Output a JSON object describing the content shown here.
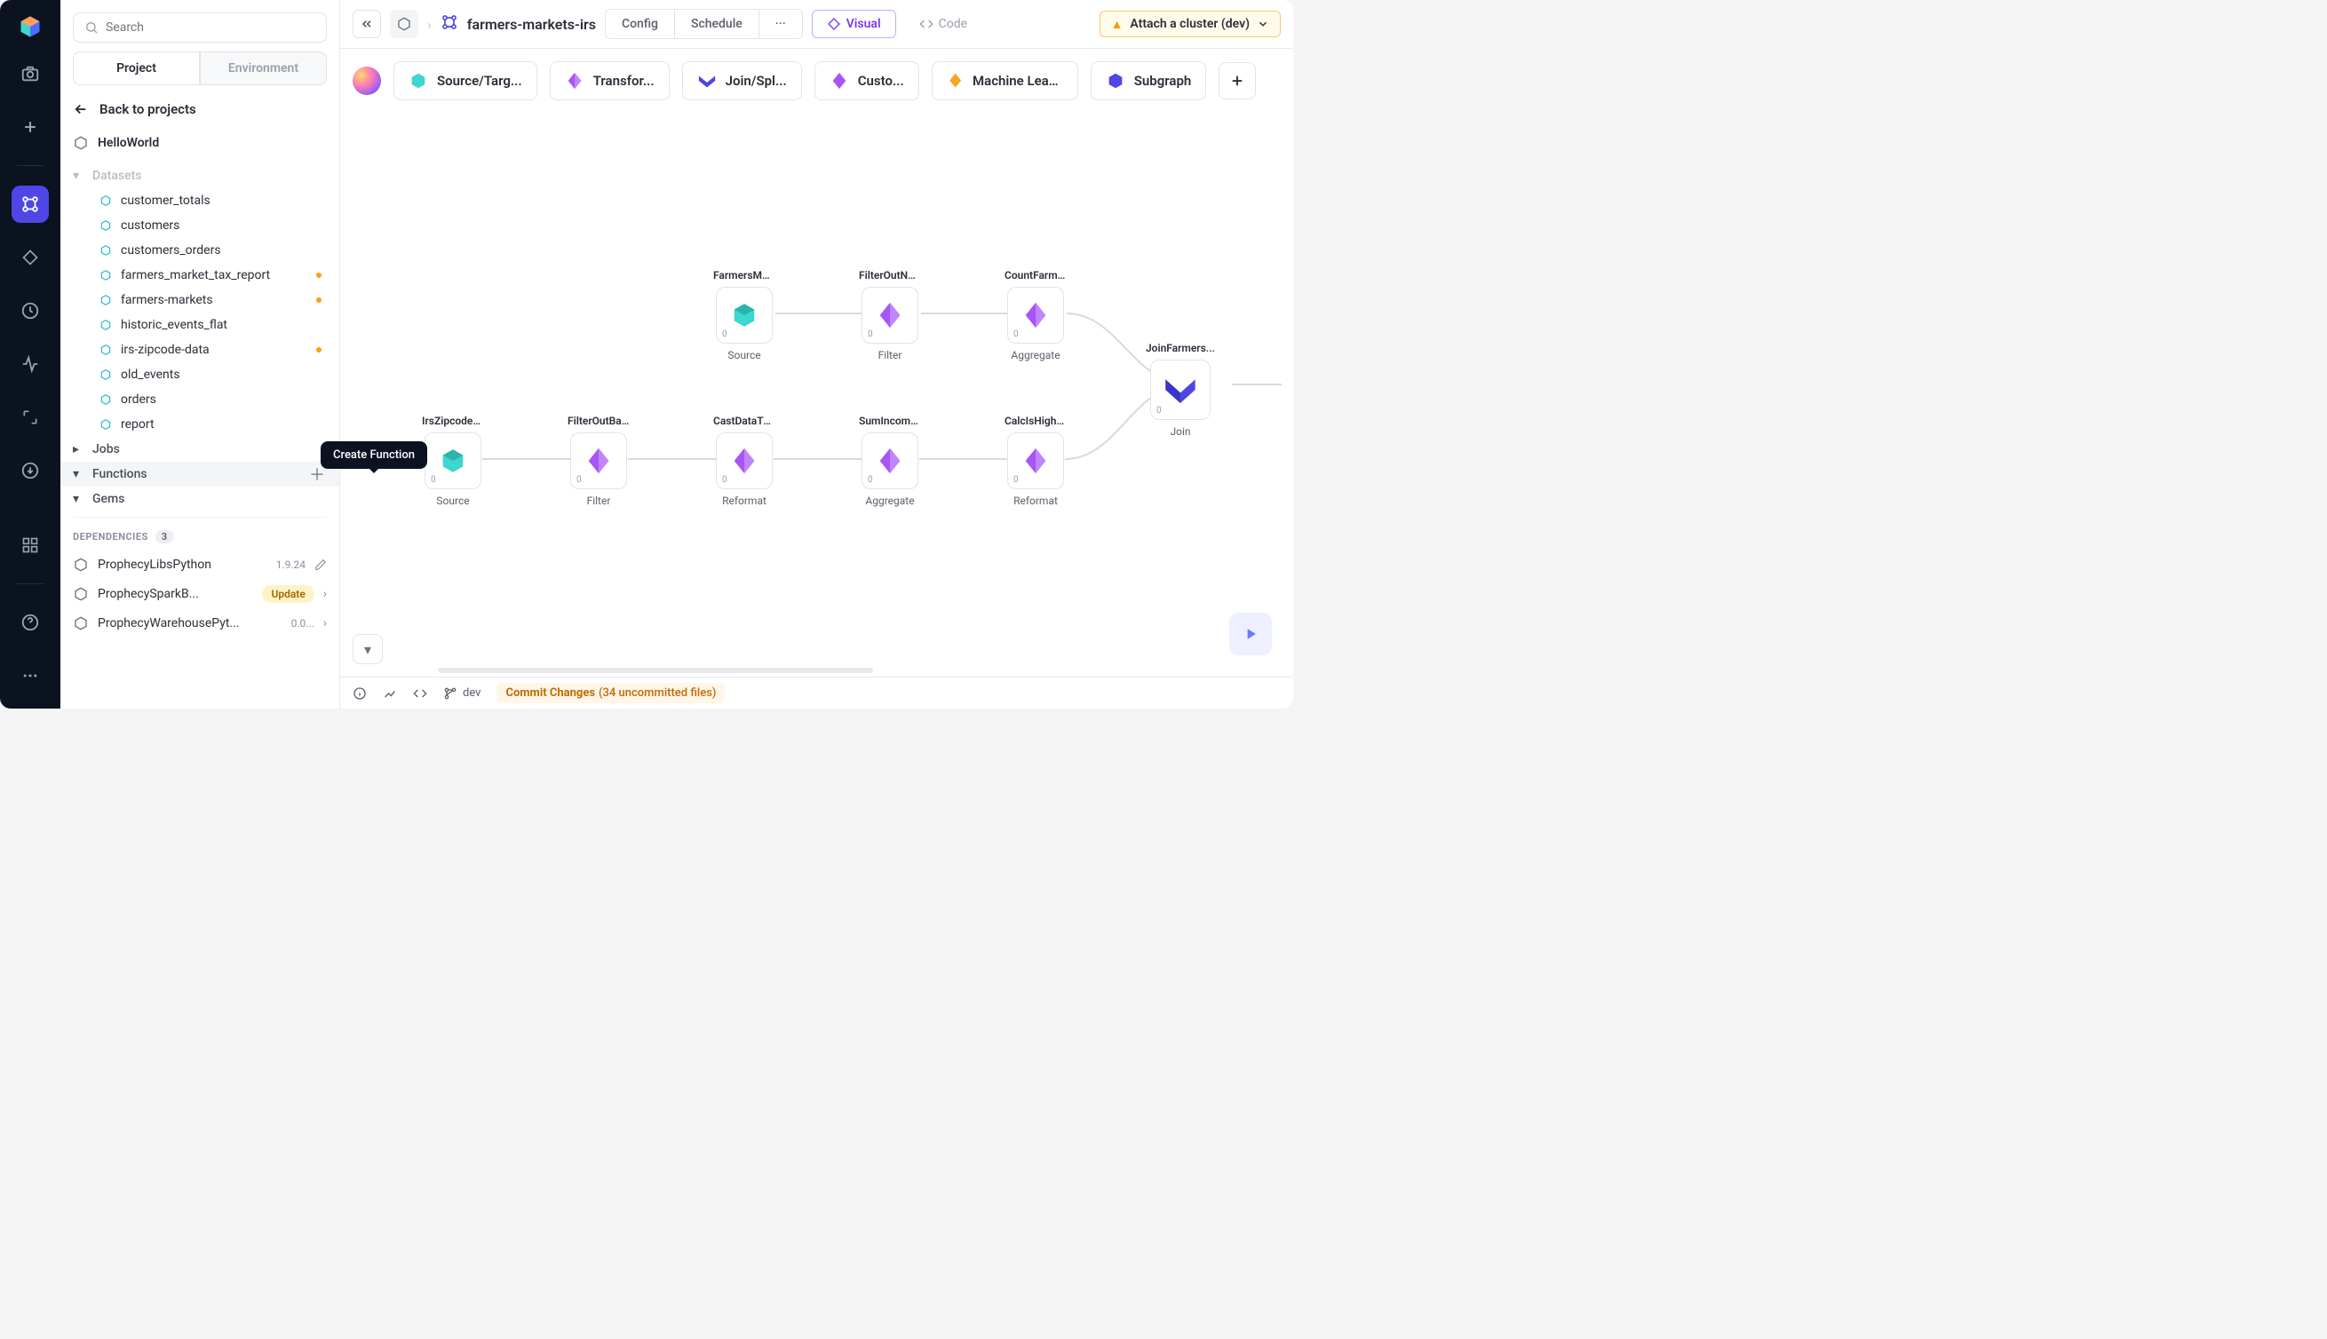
{
  "search": {
    "placeholder": "Search"
  },
  "tabs": {
    "project": "Project",
    "environment": "Environment"
  },
  "back": "Back to projects",
  "project_name": "HelloWorld",
  "sections": {
    "datasets": "Datasets",
    "jobs": "Jobs",
    "functions": "Functions",
    "gems": "Gems"
  },
  "datasets": [
    {
      "name": "customer_totals",
      "dirty": false
    },
    {
      "name": "customers",
      "dirty": false
    },
    {
      "name": "customers_orders",
      "dirty": false
    },
    {
      "name": "farmers_market_tax_report",
      "dirty": true
    },
    {
      "name": "farmers-markets",
      "dirty": true
    },
    {
      "name": "historic_events_flat",
      "dirty": false
    },
    {
      "name": "irs-zipcode-data",
      "dirty": true
    },
    {
      "name": "old_events",
      "dirty": false
    },
    {
      "name": "orders",
      "dirty": false
    },
    {
      "name": "report",
      "dirty": false
    }
  ],
  "tooltip": "Create Function",
  "dependencies": {
    "label": "DEPENDENCIES",
    "count": "3",
    "items": [
      {
        "name": "ProphecyLibsPython",
        "version": "1.9.24",
        "editable": true
      },
      {
        "name": "ProphecySparkB...",
        "update": "Update"
      },
      {
        "name": "ProphecyWarehousePyt...",
        "version": "0.0..."
      }
    ]
  },
  "breadcrumb": {
    "name": "farmers-markets-irs"
  },
  "topbar": {
    "config": "Config",
    "schedule": "Schedule",
    "visual": "Visual",
    "code": "Code",
    "attach": "Attach a cluster (dev)"
  },
  "palette": {
    "source": "Source/Targ...",
    "transform": "Transfor...",
    "join": "Join/Spl...",
    "custom": "Custo...",
    "ml": "Machine Learni...",
    "subgraph": "Subgraph"
  },
  "nodes": {
    "r1n1": {
      "top": "FarmersMark...",
      "bot": "Source",
      "count": "0"
    },
    "r1n2": {
      "top": "FilterOutNullZ...",
      "bot": "Filter",
      "count": "0"
    },
    "r1n3": {
      "top": "CountFarmer...",
      "bot": "Aggregate",
      "count": "0"
    },
    "r2n1": {
      "top": "IrsZipcodesS...",
      "bot": "Source",
      "count": "0"
    },
    "r2n2": {
      "top": "FilterOutBadZ...",
      "bot": "Filter",
      "count": "0"
    },
    "r2n3": {
      "top": "CastDataTyp...",
      "bot": "Reformat",
      "count": "0"
    },
    "r2n4": {
      "top": "SumIncomeB...",
      "bot": "Aggregate",
      "count": "0"
    },
    "r2n5": {
      "top": "CalcIsHighInc...",
      "bot": "Reformat",
      "count": "0"
    },
    "join": {
      "top": "JoinFarmers...",
      "bot": "Join",
      "count": "0"
    }
  },
  "statusbar": {
    "branch": "dev",
    "commit_label": "Commit Changes",
    "commit_sub": "(34 uncommitted files)"
  }
}
